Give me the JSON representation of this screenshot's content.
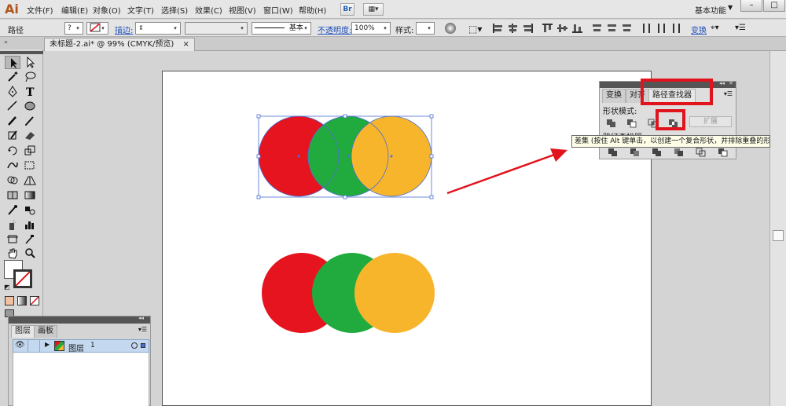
{
  "app": {
    "logo": "Ai",
    "menu": [
      "文件(F)",
      "编辑(E)",
      "对象(O)",
      "文字(T)",
      "选择(S)",
      "效果(C)",
      "视图(V)",
      "窗口(W)",
      "帮助(H)"
    ],
    "bridge": "Br",
    "workspace": "基本功能",
    "window_buttons": [
      "–",
      "□"
    ]
  },
  "control_bar": {
    "selection_type": "路径",
    "fill_value": "?",
    "stroke_label": "描边:",
    "stroke_style": "基本",
    "opacity_label": "不透明度:",
    "opacity_value": "100%",
    "style_label": "样式:",
    "transform_link": "变换"
  },
  "document": {
    "tab_title": "未标题-2.ai* @ 99% (CMYK/预览)",
    "tab_close": "×"
  },
  "pathfinder": {
    "tabs": [
      "变换",
      "对齐",
      "路径查找器"
    ],
    "shape_modes_label": "形状模式:",
    "pathfinders_label": "路径查找器:",
    "expand_button": "扩展",
    "tooltip": "差集 (按住 Alt 键单击，以创建一个复合形状，并排除重叠的形状区域)"
  },
  "layers": {
    "tabs": [
      "图层",
      "画板"
    ],
    "row": {
      "name": "图层",
      "number": "1"
    }
  },
  "artwork": {
    "colors": {
      "red": "#e6141e",
      "green": "#21ab3e",
      "yellow": "#f7b52c",
      "annotation_red": "#e1141e",
      "selection_blue": "#4a6fd6"
    },
    "selected_group_circles": [
      "red",
      "green",
      "yellow"
    ],
    "result_group_circles": [
      "red",
      "green",
      "yellow"
    ]
  }
}
